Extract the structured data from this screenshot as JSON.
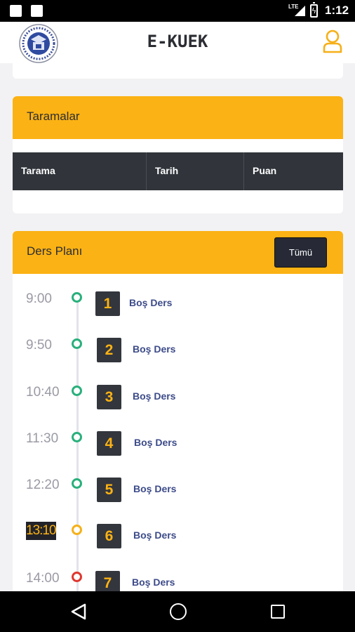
{
  "status_bar": {
    "network": "LTE",
    "time": "1:12"
  },
  "app_bar": {
    "title": "E-KUEK"
  },
  "scans": {
    "title": "Taramalar",
    "columns": [
      "Tarama",
      "Tarih",
      "Puan"
    ]
  },
  "lesson_plan": {
    "title": "Ders Planı",
    "all_button": "Tümü",
    "lessons": [
      {
        "time": "9:00",
        "number": "1",
        "name": "Boş Ders",
        "status": "done"
      },
      {
        "time": "9:50",
        "number": "2",
        "name": "Boş Ders",
        "status": "done"
      },
      {
        "time": "10:40",
        "number": "3",
        "name": "Boş Ders",
        "status": "done"
      },
      {
        "time": "11:30",
        "number": "4",
        "name": "Boş Ders",
        "status": "done"
      },
      {
        "time": "12:20",
        "number": "5",
        "name": "Boş Ders",
        "status": "done"
      },
      {
        "time": "13:10",
        "number": "6",
        "name": "Boş Ders",
        "status": "current"
      },
      {
        "time": "14:00",
        "number": "7",
        "name": "Boş Ders",
        "status": "upcoming"
      }
    ]
  },
  "colors": {
    "accent": "#fbb214",
    "done": "#29b07c",
    "current": "#f6b018",
    "upcoming": "#e0372f",
    "lesson_name": "#3c4b89"
  },
  "icons": {
    "user": "user-outline-icon",
    "logo": "school-emblem-logo"
  }
}
